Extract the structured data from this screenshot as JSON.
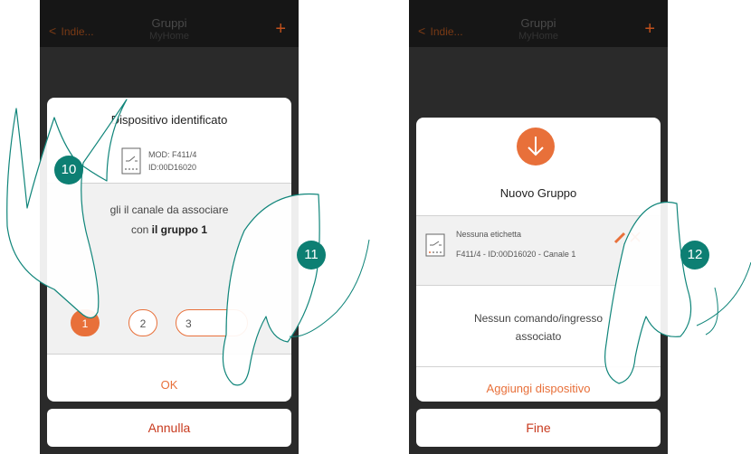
{
  "colors": {
    "accent": "#e8703a",
    "badge": "#0d7f73",
    "header_bg": "#161616",
    "phone_bg": "#1f1f1f"
  },
  "left": {
    "header": {
      "back_label": "Indie...",
      "title": "Gruppi",
      "subtitle": "MyHome"
    },
    "dialog": {
      "title": "Dispositivo identificato",
      "model": "MOD: F411/4",
      "id": "ID:00D16020",
      "instruction_pre": "gli il canale da associare",
      "instruction_con": "con ",
      "instruction_group": "il gruppo 1",
      "channels": [
        "1",
        "2",
        "3"
      ],
      "selected_channel": "1",
      "ok_label": "OK"
    },
    "cancel_label": "Annulla",
    "badges": [
      "10",
      "11"
    ]
  },
  "right": {
    "header": {
      "back_label": "Indie...",
      "title": "Gruppi",
      "subtitle": "MyHome"
    },
    "card": {
      "title": "Nuovo Gruppo",
      "device_label": "Nessuna etichetta",
      "device_detail": "F411/4 - ID:00D16020 - Canale 1",
      "empty_line1": "Nessun comando/ingresso",
      "empty_line2": "associato",
      "add_label": "Aggiungi dispositivo"
    },
    "done_label": "Fine",
    "badges": [
      "12"
    ]
  }
}
